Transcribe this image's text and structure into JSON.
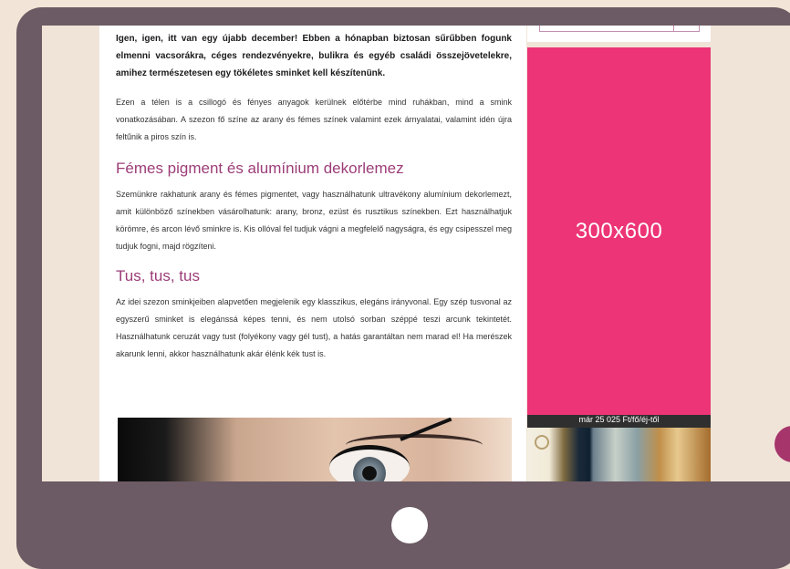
{
  "article": {
    "lead": "Igen, igen, itt van egy újabb december! Ebben a hónapban biztosan sűrűbben fogunk elmenni vacsorákra, céges rendezvényekre, bulikra és egyéb családi összejövetelekre, amihez természetesen egy tökéletes sminket kell készítenünk.",
    "intro": "Ezen a télen is a csillogó és fényes anyagok kerülnek előtérbe mind ruhákban, mind a smink vonatkozásában. A szezon fő színe az arany és fémes színek valamint ezek árnyalatai, valamint idén újra feltűnik a piros szín is.",
    "section1_title": "Fémes pigment és alumínium dekorlemez",
    "section1_text": "Szemünkre rakhatunk arany és fémes pigmentet, vagy használhatunk ultravékony alumínium dekorlemezt, amit különböző színekben vásárolhatunk: arany, bronz, ezüst és rusztikus színekben. Ezt használhatjuk körömre, és arcon lévő sminkre is. Kis ollóval fel tudjuk vágni a megfelelő nagyságra, és egy csipesszel meg tudjuk fogni, majd rögzíteni.",
    "section2_title": "Tus, tus, tus",
    "section2_text": "Az idei szezon sminkjeiben alapvetően megjelenik egy klasszikus, elegáns irányvonal. Egy szép tusvonal az egyszerű sminket is elegánssá képes tenni, és nem utolsó sorban széppé teszi arcunk tekintetét. Használhatunk ceruzát vagy tust (folyékony vagy gél tust), a hatás garantáltan nem marad el! Ha merészek akarunk lenni, akkor használhatunk akár élénk kék tust is."
  },
  "sidebar": {
    "ad_label": "300x600",
    "promo_text": "már 25 025 Ft/fő/éj-től"
  },
  "colors": {
    "frame": "#6c5b64",
    "ad": "#ec3476",
    "heading": "#9c3d78"
  }
}
